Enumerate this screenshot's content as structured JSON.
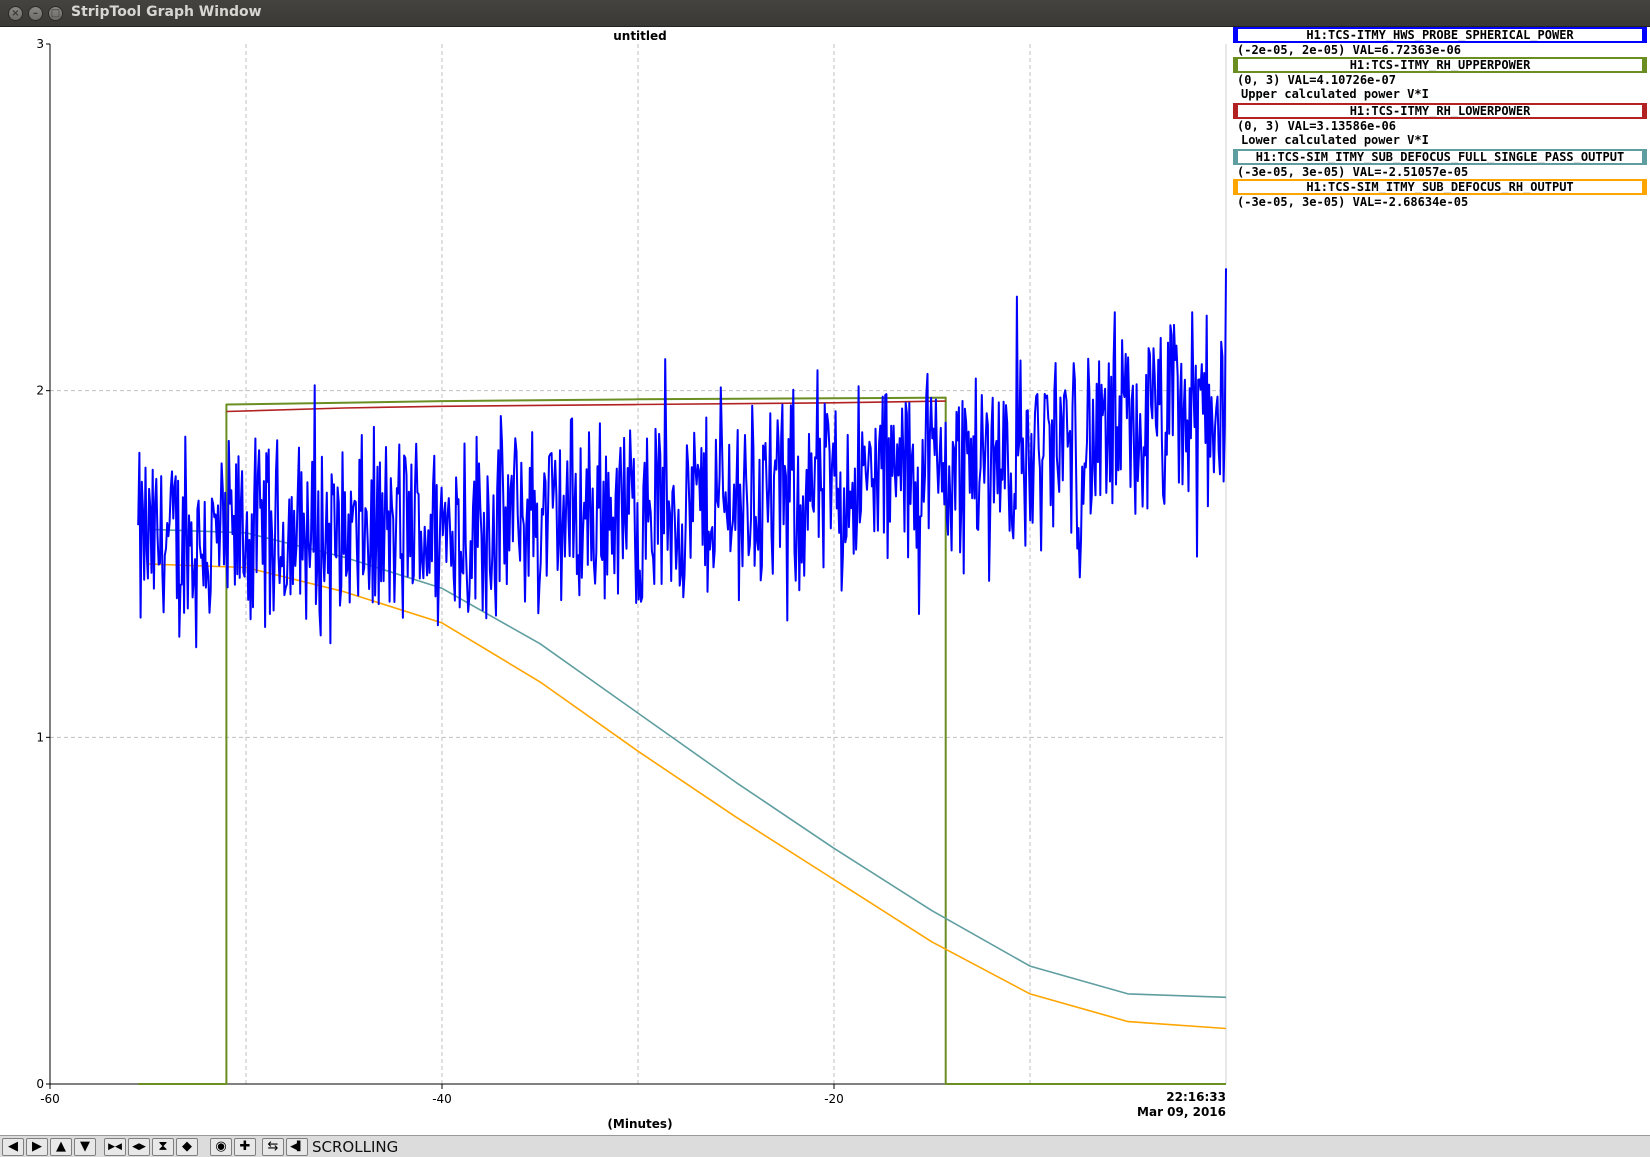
{
  "window": {
    "title": "StripTool Graph Window",
    "close_glyph": "×",
    "min_glyph": "–",
    "max_glyph": "□"
  },
  "graph": {
    "title": "untitled",
    "xlabel": "(Minutes)",
    "time_label": "22:16:33",
    "date_label": "Mar 09, 2016"
  },
  "legend": [
    {
      "name": "H1:TCS-ITMY_HWS_PROBE_SPHERICAL_POWER",
      "value_text": "(-2e-05, 2e-05) VAL=6.72363e-06",
      "description": "",
      "color": "#0000ff"
    },
    {
      "name": "H1:TCS-ITMY_RH_UPPERPOWER",
      "value_text": "(0, 3) VAL=4.10726e-07",
      "description": "Upper calculated power V*I",
      "color": "#6b8e23"
    },
    {
      "name": "H1:TCS-ITMY_RH_LOWERPOWER",
      "value_text": "(0, 3) VAL=3.13586e-06",
      "description": "Lower calculated power V*I",
      "color": "#b22222"
    },
    {
      "name": "H1:TCS-SIM_ITMY_SUB_DEFOCUS_FULL_SINGLE_PASS_OUTPUT",
      "value_text": "(-3e-05, 3e-05) VAL=-2.51057e-05",
      "description": "",
      "color": "#5f9ea0"
    },
    {
      "name": "H1:TCS-SIM_ITMY_SUB_DEFOCUS_RH_OUTPUT",
      "value_text": "(-3e-05, 3e-05) VAL=-2.68634e-05",
      "description": "",
      "color": "#ffa500"
    }
  ],
  "toolbar": {
    "buttons": [
      {
        "name": "pan-left-button",
        "glyph": "◀"
      },
      {
        "name": "pan-right-button",
        "glyph": "▶"
      },
      {
        "name": "pan-up-button",
        "glyph": "▲"
      },
      {
        "name": "pan-down-button",
        "glyph": "▼"
      },
      {
        "name": "zoom-in-x-button",
        "glyph": "▶◀"
      },
      {
        "name": "zoom-out-x-button",
        "glyph": "◀▶"
      },
      {
        "name": "zoom-in-y-button",
        "glyph": "⧗"
      },
      {
        "name": "zoom-out-y-button",
        "glyph": "◆"
      },
      {
        "name": "auto-scale-button",
        "glyph": "◉"
      },
      {
        "name": "reset-button",
        "glyph": "✚"
      },
      {
        "name": "refresh-button",
        "glyph": "⇆"
      },
      {
        "name": "scroll-mode-button",
        "glyph": "◀▌"
      }
    ],
    "mode_label": "SCROLLING"
  },
  "chart_data": {
    "type": "line",
    "title": "untitled",
    "xlabel": "(Minutes)",
    "ylabel": "",
    "xlim": [
      -60,
      0
    ],
    "ylim": [
      0,
      3
    ],
    "x_ticks": [
      "-60",
      "-40",
      "-20"
    ],
    "y_ticks": [
      "0",
      "1",
      "2",
      "3"
    ],
    "grid": true,
    "legend_position": "right",
    "series": [
      {
        "name": "H1:TCS-ITMY_HWS_PROBE_SPHERICAL_POWER",
        "color": "#0000ff",
        "style": "noisy",
        "x": [
          -55.5,
          -50,
          -45,
          -40,
          -35,
          -30,
          -25,
          -20,
          -15,
          -10,
          -5,
          -2,
          0
        ],
        "values": [
          1.55,
          1.57,
          1.58,
          1.6,
          1.63,
          1.66,
          1.68,
          1.72,
          1.77,
          1.82,
          1.87,
          1.93,
          1.97
        ],
        "noise_amplitude": 0.28
      },
      {
        "name": "H1:TCS-ITMY_RH_UPPERPOWER",
        "color": "#6b8e23",
        "x": [
          -55.5,
          -51,
          -51,
          -45,
          -40,
          -30,
          -20,
          -14.3,
          -14.3,
          0
        ],
        "values": [
          0.0,
          0.0,
          1.96,
          1.965,
          1.97,
          1.975,
          1.978,
          1.98,
          0.0,
          0.0
        ]
      },
      {
        "name": "H1:TCS-ITMY_RH_LOWERPOWER",
        "color": "#b22222",
        "x": [
          -51,
          -45,
          -40,
          -30,
          -20,
          -14.3
        ],
        "values": [
          1.94,
          1.95,
          1.955,
          1.96,
          1.965,
          1.97
        ]
      },
      {
        "name": "H1:TCS-SIM_ITMY_SUB_DEFOCUS_FULL_SINGLE_PASS_OUTPUT",
        "color": "#5f9ea0",
        "x": [
          -55,
          -50,
          -45,
          -40,
          -35,
          -30,
          -25,
          -20,
          -15,
          -10,
          -5,
          0
        ],
        "values": [
          1.6,
          1.59,
          1.52,
          1.43,
          1.27,
          1.07,
          0.87,
          0.68,
          0.5,
          0.34,
          0.26,
          0.25
        ]
      },
      {
        "name": "H1:TCS-SIM_ITMY_SUB_DEFOCUS_RH_OUTPUT",
        "color": "#ffa500",
        "x": [
          -55,
          -50,
          -45,
          -40,
          -35,
          -30,
          -25,
          -20,
          -15,
          -10,
          -5,
          0
        ],
        "values": [
          1.5,
          1.49,
          1.42,
          1.33,
          1.16,
          0.96,
          0.77,
          0.59,
          0.41,
          0.26,
          0.18,
          0.16
        ]
      }
    ]
  }
}
